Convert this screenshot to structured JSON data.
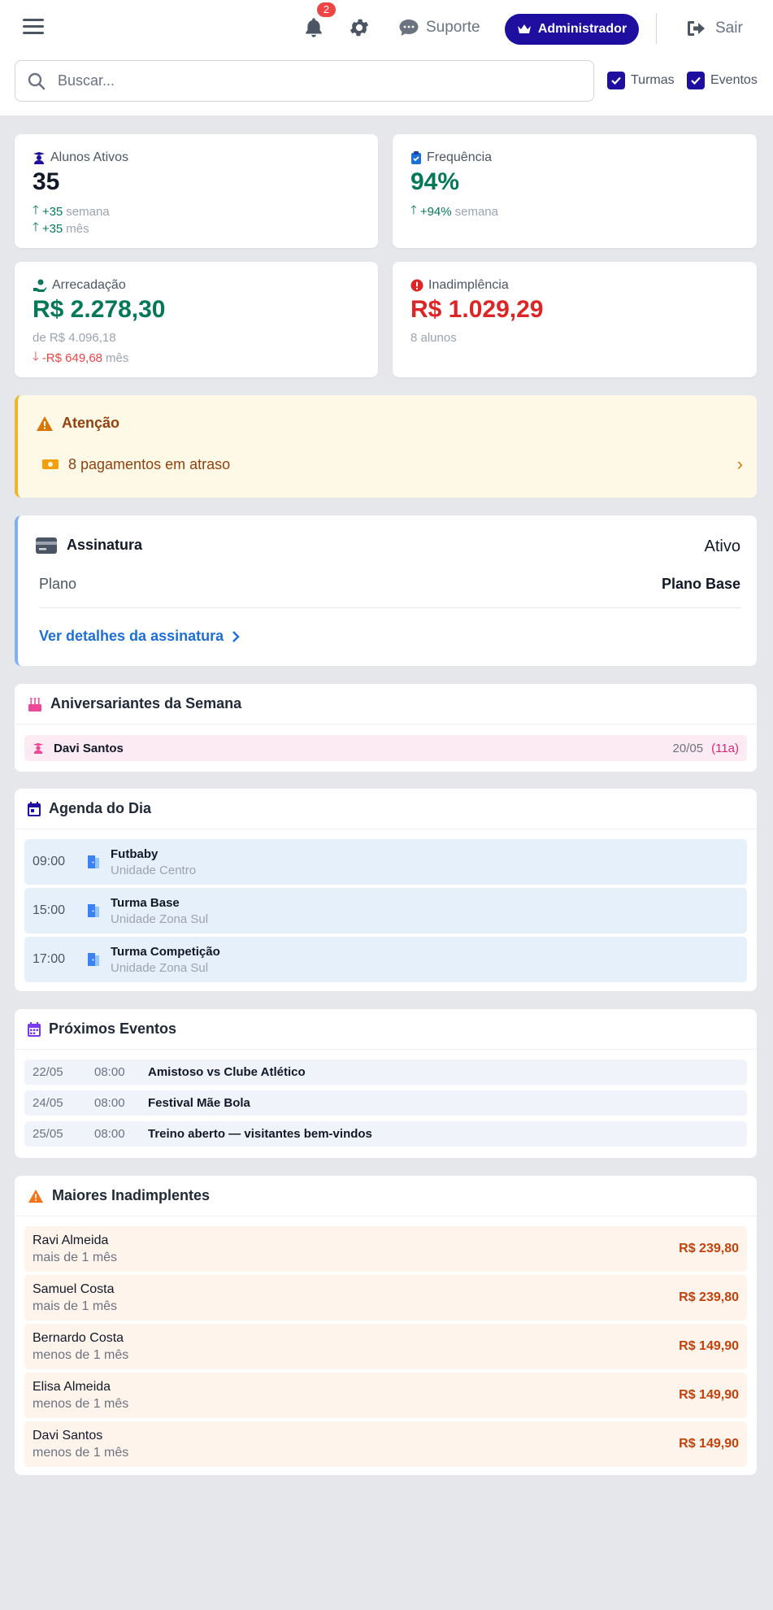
{
  "header": {
    "notifications_count": "2",
    "support_label": "Suporte",
    "admin_label": "Administrador",
    "logout_label": "Sair",
    "search_placeholder": "Buscar...",
    "filter_classes": "Turmas",
    "filter_events": "Eventos"
  },
  "stats": {
    "active": {
      "label": "Alunos Ativos",
      "value": "35",
      "week_delta": "+35",
      "week_label": "semana",
      "month_delta": "+35",
      "month_label": "mês"
    },
    "attendance": {
      "label": "Frequência",
      "value": "94%",
      "week_delta": "+94%",
      "week_label": "semana"
    },
    "revenue": {
      "label": "Arrecadação",
      "value": "R$ 2.278,30",
      "of_total": "de R$ 4.096,18",
      "month_delta": "-R$ 649,68",
      "month_label": "mês"
    },
    "default": {
      "label": "Inadimplência",
      "value": "R$ 1.029,29",
      "students": "8 alunos"
    }
  },
  "attention": {
    "title": "Atenção",
    "message": "8 pagamentos em atraso"
  },
  "subscription": {
    "title": "Assinatura",
    "status": "Ativo",
    "plan_label": "Plano",
    "plan_value": "Plano Base",
    "details_link": "Ver detalhes da assinatura"
  },
  "birthdays": {
    "title": "Aniversariantes da Semana",
    "items": [
      {
        "name": "Davi Santos",
        "date": "20/05",
        "age": "(11a)"
      }
    ]
  },
  "agenda": {
    "title": "Agenda do Dia",
    "items": [
      {
        "time": "09:00",
        "name": "Futbaby",
        "unit": "Unidade Centro"
      },
      {
        "time": "15:00",
        "name": "Turma Base",
        "unit": "Unidade Zona Sul"
      },
      {
        "time": "17:00",
        "name": "Turma Competição",
        "unit": "Unidade Zona Sul"
      }
    ]
  },
  "events": {
    "title": "Próximos Eventos",
    "items": [
      {
        "date": "22/05",
        "time": "08:00",
        "name": "Amistoso vs Clube Atlético"
      },
      {
        "date": "24/05",
        "time": "08:00",
        "name": "Festival Mãe Bola"
      },
      {
        "date": "25/05",
        "time": "08:00",
        "name": "Treino aberto — visitantes bem-vindos"
      }
    ]
  },
  "debtors": {
    "title": "Maiores Inadimplentes",
    "items": [
      {
        "name": "Ravi Almeida",
        "period": "mais de 1 mês",
        "amount": "R$ 239,80"
      },
      {
        "name": "Samuel Costa",
        "period": "mais de 1 mês",
        "amount": "R$ 239,80"
      },
      {
        "name": "Bernardo Costa",
        "period": "menos de 1 mês",
        "amount": "R$ 149,90"
      },
      {
        "name": "Elisa Almeida",
        "period": "menos de 1 mês",
        "amount": "R$ 149,90"
      },
      {
        "name": "Davi Santos",
        "period": "menos de 1 mês",
        "amount": "R$ 149,90"
      }
    ]
  },
  "colors": {
    "brand": "#1e0fa0",
    "positive": "#047857",
    "negative": "#dc2626",
    "warning": "#92400e",
    "link": "#1d6fd6"
  }
}
